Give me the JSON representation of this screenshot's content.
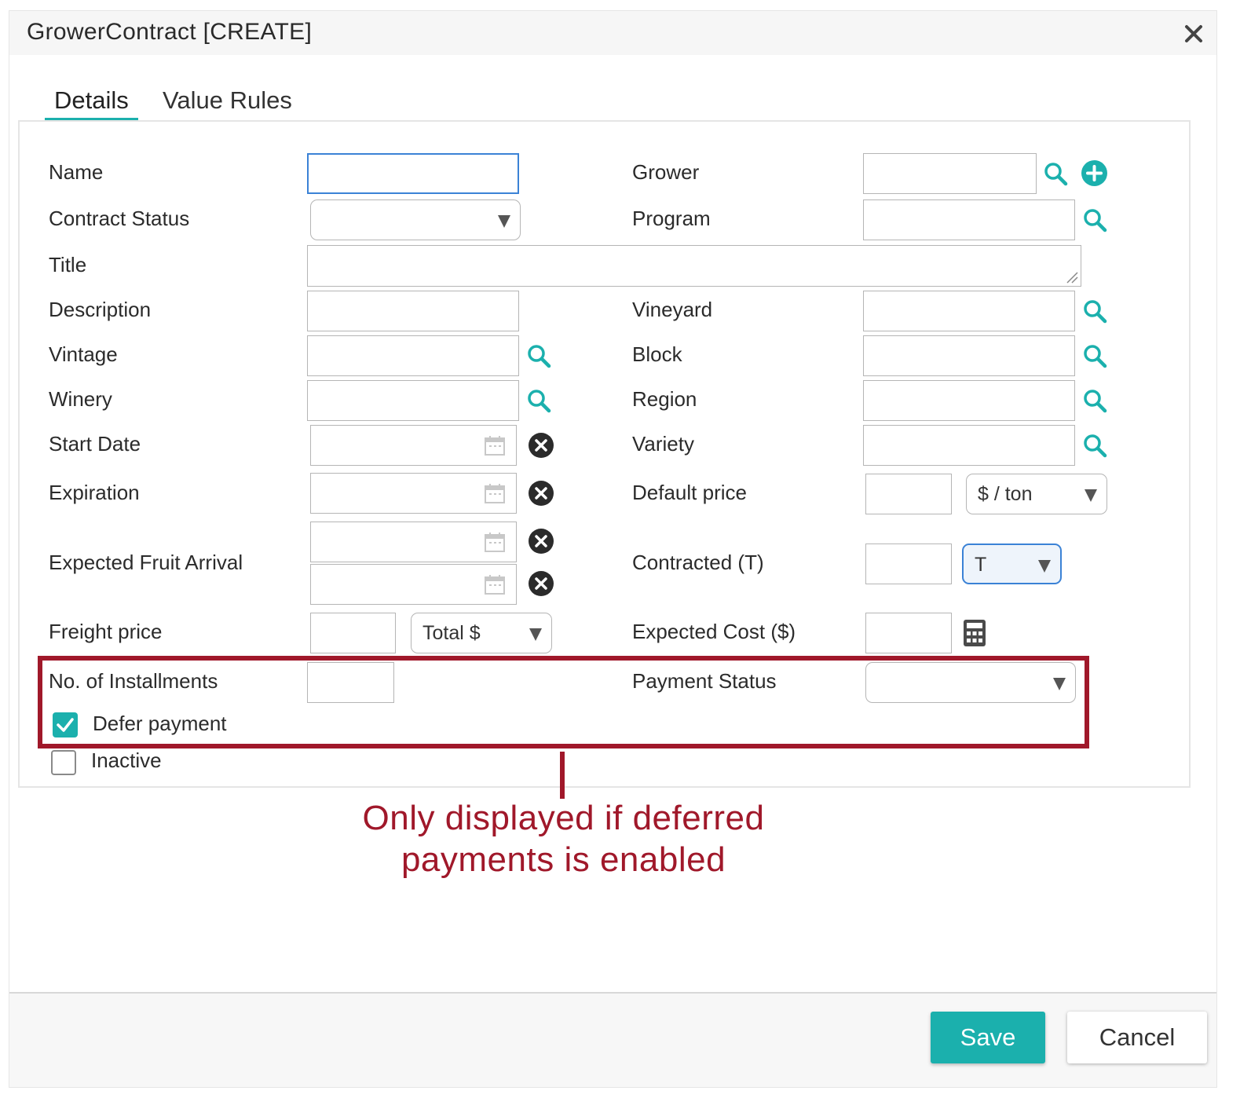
{
  "dialog": {
    "title": "GrowerContract [CREATE]"
  },
  "tabs": [
    {
      "label": "Details"
    },
    {
      "label": "Value Rules"
    }
  ],
  "fields": {
    "name": "Name",
    "contract_status": "Contract Status",
    "title": "Title",
    "description": "Description",
    "vintage": "Vintage",
    "winery": "Winery",
    "start_date": "Start Date",
    "expiration": "Expiration",
    "expected_fruit_arrival": "Expected Fruit Arrival",
    "freight_price": "Freight price",
    "installments": "No. of Installments",
    "defer_payment": "Defer payment",
    "inactive": "Inactive",
    "grower": "Grower",
    "program": "Program",
    "vineyard": "Vineyard",
    "block": "Block",
    "region": "Region",
    "variety": "Variety",
    "default_price": "Default price",
    "contracted": "Contracted (T)",
    "expected_cost": "Expected Cost ($)",
    "payment_status": "Payment Status"
  },
  "selects": {
    "default_price_unit": "$ / ton",
    "contracted_unit": "T",
    "freight_unit": "Total $"
  },
  "checkboxes": {
    "defer_payment": true,
    "inactive": false
  },
  "annotation": {
    "line1": "Only displayed if deferred",
    "line2": "payments is enabled",
    "color": "#a0182a"
  },
  "buttons": {
    "save": "Save",
    "cancel": "Cancel"
  },
  "colors": {
    "accent": "#1bb0ad",
    "focus": "#3b82d6"
  }
}
